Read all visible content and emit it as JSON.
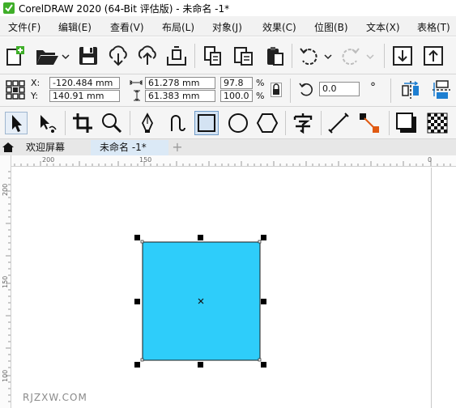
{
  "window": {
    "title": "CorelDRAW 2020 (64-Bit 评估版) - 未命名 -1*"
  },
  "menubar": {
    "items": [
      "文件(F)",
      "编辑(E)",
      "查看(V)",
      "布局(L)",
      "对象(J)",
      "效果(C)",
      "位图(B)",
      "文本(X)",
      "表格(T)"
    ]
  },
  "property_bar": {
    "x_label": "X:",
    "y_label": "Y:",
    "x_value": "-120.484 mm",
    "y_value": "140.91 mm",
    "width_value": "61.278 mm",
    "height_value": "61.383 mm",
    "scale_x": "97.8",
    "scale_y": "100.0",
    "percent_symbol": "%",
    "rotation_value": "0.0",
    "degree_symbol": "°"
  },
  "tabs": {
    "welcome": "欢迎屏幕",
    "document": "未命名 -1*",
    "add": "+"
  },
  "ruler": {
    "horizontal_labels": [
      "200",
      "150",
      "0"
    ],
    "vertical_labels": [
      "200",
      "150",
      "100"
    ]
  },
  "shape": {
    "type": "rectangle",
    "fill": "#2ecdfa",
    "outline": "#1a1a1a",
    "selected": true
  },
  "colors": {
    "app_logo": "#3fae29",
    "accent_blue": "#1e7fd1",
    "active_tab": "#dbe9f6"
  },
  "icons": [
    "app-logo-icon",
    "new-document-icon",
    "open-folder-icon",
    "save-icon",
    "import-icon",
    "export-icon",
    "publish-pdf-icon",
    "copy-icon",
    "paste-icon",
    "clipboard-icon",
    "undo-icon",
    "redo-icon",
    "align-icon",
    "transform-icon",
    "lock-icon",
    "rotate-icon",
    "mirror-horizontal-icon",
    "mirror-vertical-icon",
    "pick-tool-icon",
    "shape-tool-icon",
    "crop-tool-icon",
    "zoom-tool-icon",
    "pen-tool-icon",
    "artistic-media-icon",
    "rectangle-tool-icon",
    "ellipse-tool-icon",
    "polygon-tool-icon",
    "text-tool-icon",
    "dimension-tool-icon",
    "connector-tool-icon",
    "drop-shadow-tool-icon",
    "transparency-tool-icon",
    "home-icon"
  ],
  "watermark": "RJZXW.COM"
}
